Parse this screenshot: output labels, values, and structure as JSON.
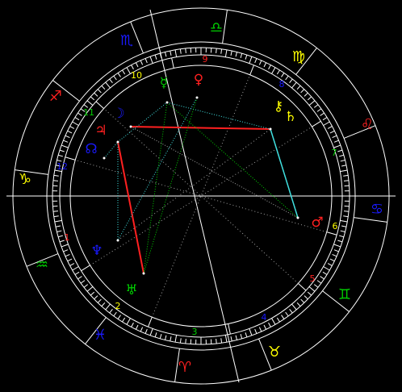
{
  "signs": [
    {
      "glyph": "♋",
      "color": "#1a1aff"
    },
    {
      "glyph": "♌",
      "color": "#ff2020"
    },
    {
      "glyph": "♍",
      "color": "#ffff00"
    },
    {
      "glyph": "♎",
      "color": "#00d000"
    },
    {
      "glyph": "♏",
      "color": "#1a1aff"
    },
    {
      "glyph": "♐",
      "color": "#ff2020"
    },
    {
      "glyph": "♑",
      "color": "#ffff00"
    },
    {
      "glyph": "♒",
      "color": "#00d000"
    },
    {
      "glyph": "♓",
      "color": "#1a1aff"
    },
    {
      "glyph": "♈",
      "color": "#ff2020"
    },
    {
      "glyph": "♉",
      "color": "#ffff00"
    },
    {
      "glyph": "♊",
      "color": "#00d000"
    }
  ],
  "houses": [
    {
      "label": "1",
      "color": "#ff2020"
    },
    {
      "label": "2",
      "color": "#ffff00"
    },
    {
      "label": "3",
      "color": "#00d000"
    },
    {
      "label": "4",
      "color": "#1a1aff"
    },
    {
      "label": "5",
      "color": "#ff2020"
    },
    {
      "label": "6",
      "color": "#ffff00"
    },
    {
      "label": "7",
      "color": "#00d000"
    },
    {
      "label": "8",
      "color": "#1a1aff"
    },
    {
      "label": "9",
      "color": "#ff2020"
    },
    {
      "label": "10",
      "color": "#ffff00"
    },
    {
      "label": "11",
      "color": "#00d000"
    },
    {
      "label": "12",
      "color": "#1a1aff"
    }
  ],
  "planets": [
    {
      "glyph": "☿",
      "color": "#00d000"
    },
    {
      "glyph": "♀",
      "color": "#ff2020"
    },
    {
      "glyph": "☽",
      "color": "#1a1aff"
    },
    {
      "glyph": "♃",
      "color": "#ff2020"
    },
    {
      "glyph": "☊",
      "color": "#1a1aff"
    },
    {
      "glyph": "⚷",
      "color": "#ffff00"
    },
    {
      "glyph": "♄",
      "color": "#ffff00"
    },
    {
      "glyph": "♂",
      "color": "#ff2020"
    },
    {
      "glyph": "♆",
      "color": "#1a1aff"
    },
    {
      "glyph": "♅",
      "color": "#00d000"
    }
  ],
  "colors": {
    "background": "#000000",
    "lines": "#ffffff",
    "aspect_red": "#ff2020",
    "aspect_cyan": "#40e0e0",
    "aspect_green": "#00d000",
    "aspect_grey": "#a0a0a0"
  }
}
